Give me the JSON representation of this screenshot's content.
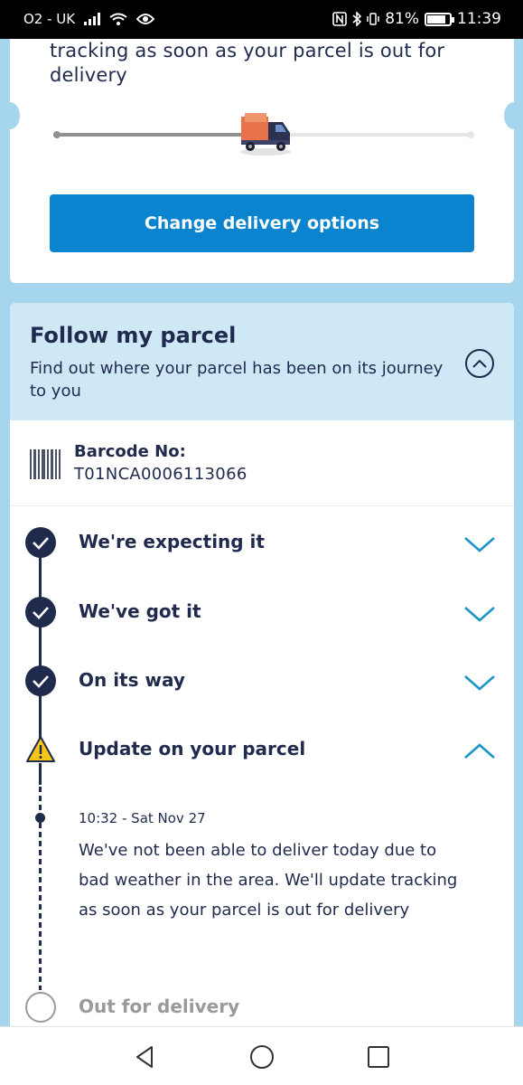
{
  "status_bar": {
    "carrier": "O2 - UK",
    "battery": "81%",
    "time": "11:39"
  },
  "top_card": {
    "message_tail": "tracking as soon as your parcel is out for delivery",
    "progress_fraction": 0.5,
    "change_button": "Change delivery options"
  },
  "follow": {
    "title": "Follow my parcel",
    "subtitle": "Find out where your parcel has been on its journey to you",
    "barcode_label": "Barcode No:",
    "barcode_value": "T01NCA0006113066"
  },
  "timeline": {
    "steps": [
      {
        "label": "We're expecting it",
        "state": "done"
      },
      {
        "label": "We've got it",
        "state": "done"
      },
      {
        "label": "On its way",
        "state": "done"
      },
      {
        "label": "Update on your parcel",
        "state": "warning",
        "expanded": true
      },
      {
        "label": "Out for delivery",
        "state": "pending"
      }
    ],
    "update": {
      "time": "10:32 - Sat Nov 27",
      "message": "We've not been able to deliver today due to bad weather in the area. We'll update tracking as soon as your parcel is out for delivery"
    }
  },
  "colors": {
    "primary": "#0b84d0",
    "navy": "#1f2a4d",
    "accent": "#1c95c9",
    "warning": "#f5c518",
    "page_bg": "#a6d5ee",
    "header_bg": "#cfe8f6"
  }
}
